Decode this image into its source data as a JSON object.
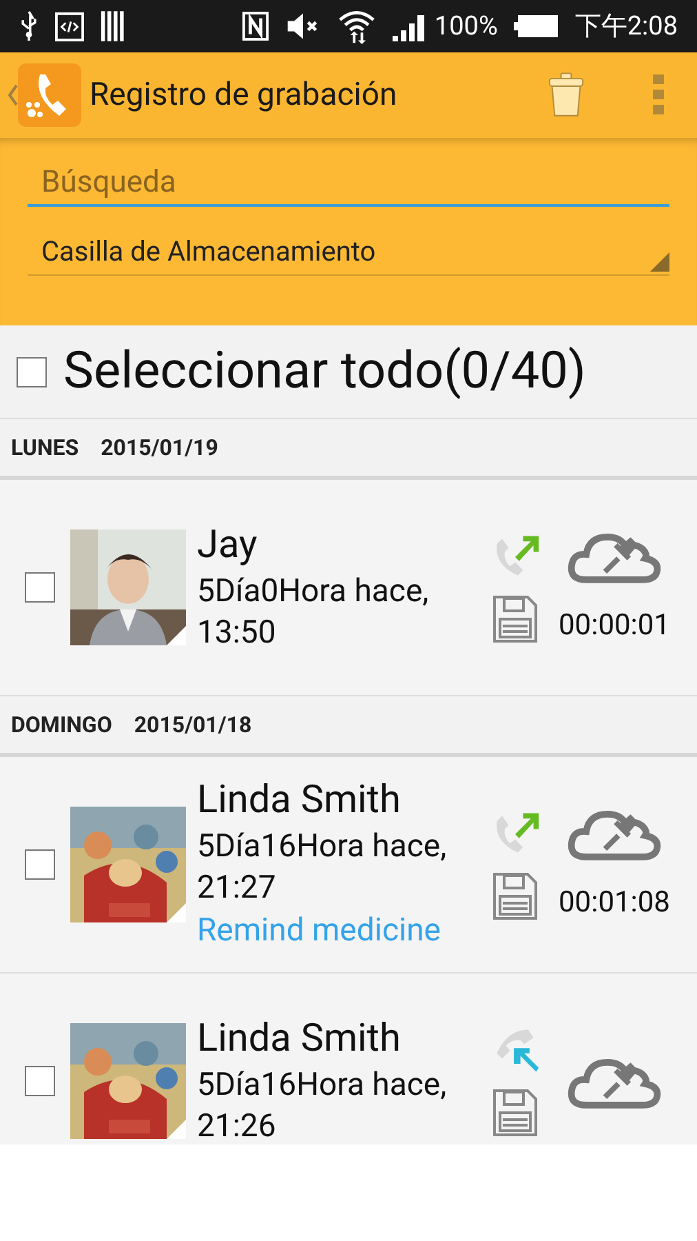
{
  "status_bar": {
    "battery": "100%",
    "time": "下午2:08"
  },
  "action_bar": {
    "title": "Registro de grabación"
  },
  "search": {
    "placeholder": "Búsqueda"
  },
  "storage_dropdown": {
    "value": "Casilla de Almacenamiento"
  },
  "select_all": {
    "label": "Seleccionar todo(0/40)",
    "checked": false
  },
  "sections": [
    {
      "day": "LUNES",
      "date": "2015/01/19",
      "items": [
        {
          "name": "Jay",
          "time": "5Día0Hora hace, 13:50",
          "kind": "outgoing",
          "duration": "00:00:01",
          "checked": false
        }
      ]
    },
    {
      "day": "DOMINGO",
      "date": "2015/01/18",
      "items": [
        {
          "name": "Linda Smith",
          "time": "5Día16Hora hace, 21:27",
          "note": "Remind medicine",
          "kind": "outgoing",
          "duration": "00:01:08",
          "checked": false
        },
        {
          "name": "Linda Smith",
          "time": "5Día16Hora hace, 21:26",
          "kind": "incoming",
          "checked": false
        }
      ]
    }
  ]
}
